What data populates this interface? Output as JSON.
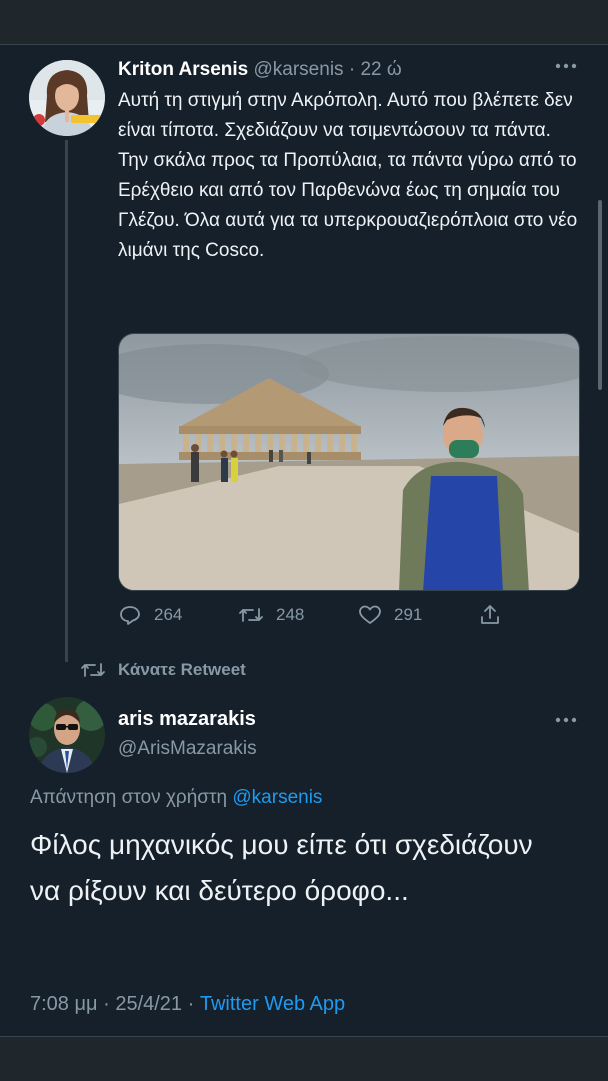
{
  "tweet": {
    "author_name": "Kriton Arsenis",
    "author_handle": "@karsenis",
    "separator": "·",
    "time": "22 ώ",
    "more_icon": "more-horizontal-icon",
    "text": "Αυτή τη στιγμή στην Ακρόπολη. Αυτό που βλέπετε δεν είναι τίποτα. Σχεδιάζουν να τσιμεντώσουν τα πάντα. Την σκάλα προς τα Προπύλαια, τα πάντα γύρω από το Ερέχθειο και από τον Παρθενώνα έως τη σημαία του Γλέζου. Όλα αυτά για τα υπερκρουαζιερόπλοια στο νέο λιμάνι της Cosco.",
    "stats": {
      "replies": "264",
      "retweets": "248",
      "likes": "291"
    }
  },
  "retweet_notice": {
    "label": "Κάνατε Retweet",
    "icon": "retweet-icon"
  },
  "reply": {
    "author_name": "aris mazarakis",
    "author_handle": "@ArisMazarakis",
    "reply_prefix": "Απάντηση στον χρήστη",
    "reply_to": "@karsenis",
    "text": "Φίλος μηχανικός μου είπε ότι σχεδιάζουν να ρίξουν και δεύτερο όροφο...",
    "time": "7:08 μμ",
    "separator": "·",
    "date": "25/4/21",
    "source": "Twitter Web App"
  },
  "colors": {
    "background": "#15202b",
    "accent": "#1d9bf0",
    "muted": "#8899a6"
  }
}
